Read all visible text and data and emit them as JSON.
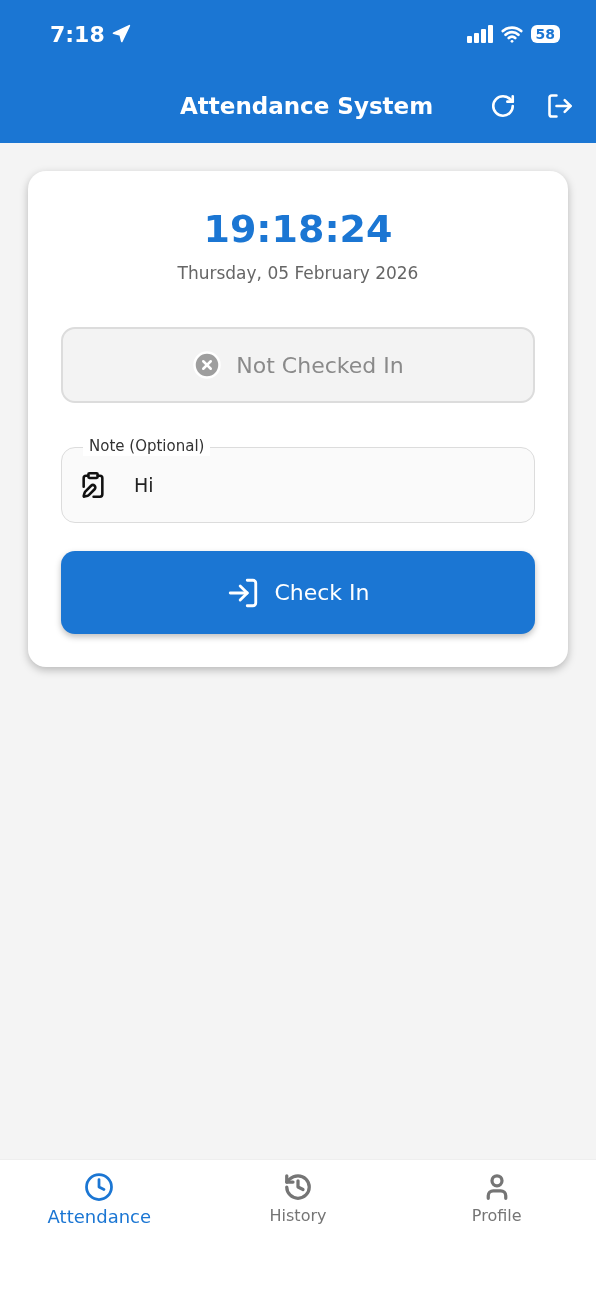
{
  "status_bar": {
    "time": "7:18",
    "battery": "58"
  },
  "app_bar": {
    "title": "Attendance System"
  },
  "clock": {
    "time": "19:18:24",
    "date": "Thursday, 05 February 2026"
  },
  "status": {
    "checked_in": false,
    "label": "Not Checked In"
  },
  "note_field": {
    "label": "Note (Optional)",
    "value": "Hi"
  },
  "action_button": {
    "label": "Check In"
  },
  "tabs": [
    {
      "label": "Attendance",
      "kind": "clock",
      "selected": true
    },
    {
      "label": "History",
      "kind": "history",
      "selected": false
    },
    {
      "label": "Profile",
      "kind": "person",
      "selected": false
    }
  ]
}
